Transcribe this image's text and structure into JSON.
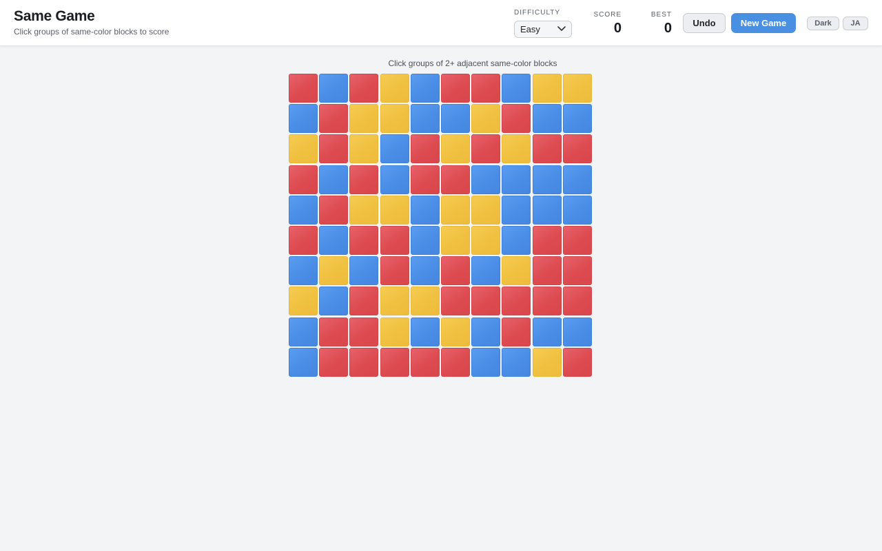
{
  "header": {
    "title": "Same Game",
    "subtitle": "Click groups of same-color blocks to score",
    "difficulty_label": "DIFFICULTY",
    "difficulty_value": "Easy",
    "score_label": "SCORE",
    "score_value": "0",
    "best_label": "BEST",
    "best_value": "0",
    "undo_label": "Undo",
    "new_game_label": "New Game",
    "theme_toggle_label": "Dark",
    "language_toggle_label": "JA"
  },
  "hint": "Click groups of 2+ adjacent same-color blocks",
  "colors": {
    "red": "#dc4b50",
    "blue": "#4a8de6",
    "yellow": "#f0c040",
    "accent": "#4a90e2"
  },
  "board": {
    "rows": 10,
    "cols": 10,
    "grid": [
      [
        "R",
        "B",
        "R",
        "Y",
        "B",
        "R",
        "R",
        "B",
        "Y",
        "Y"
      ],
      [
        "B",
        "R",
        "Y",
        "Y",
        "B",
        "B",
        "Y",
        "R",
        "B",
        "B"
      ],
      [
        "Y",
        "R",
        "Y",
        "B",
        "R",
        "Y",
        "R",
        "Y",
        "R",
        "R"
      ],
      [
        "R",
        "B",
        "R",
        "B",
        "R",
        "R",
        "B",
        "B",
        "B",
        "B"
      ],
      [
        "B",
        "R",
        "Y",
        "Y",
        "B",
        "Y",
        "Y",
        "B",
        "B",
        "B"
      ],
      [
        "R",
        "B",
        "R",
        "R",
        "B",
        "Y",
        "Y",
        "B",
        "R",
        "R"
      ],
      [
        "B",
        "Y",
        "B",
        "R",
        "B",
        "R",
        "B",
        "Y",
        "R",
        "R"
      ],
      [
        "Y",
        "B",
        "R",
        "Y",
        "Y",
        "R",
        "R",
        "R",
        "R",
        "R"
      ],
      [
        "B",
        "R",
        "R",
        "Y",
        "B",
        "Y",
        "B",
        "R",
        "B",
        "B"
      ],
      [
        "B",
        "R",
        "R",
        "R",
        "R",
        "R",
        "B",
        "B",
        "Y",
        "R"
      ]
    ]
  }
}
